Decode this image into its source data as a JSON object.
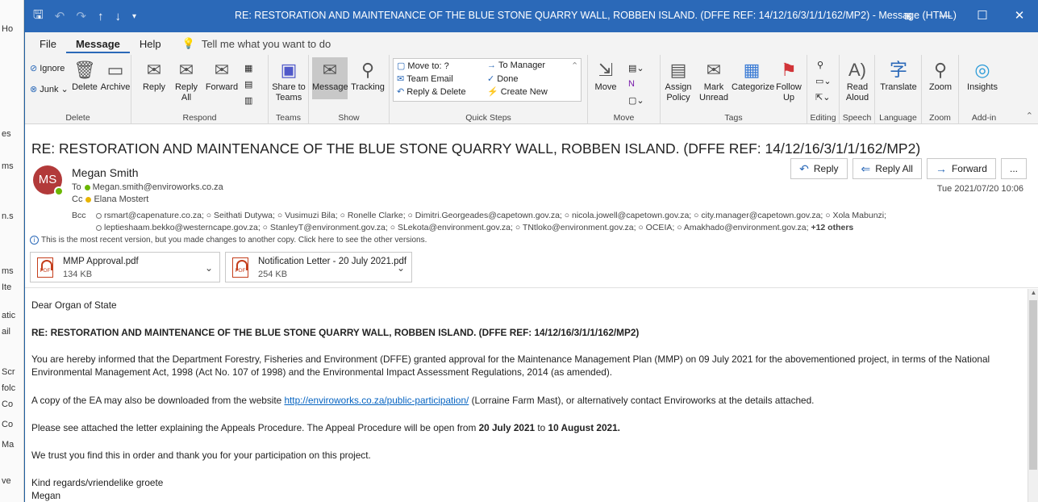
{
  "bg_strip": [
    "Ho",
    "es",
    "ms",
    "n.s",
    "ms",
    "Ite",
    "atic",
    "ail",
    "Scr",
    "folc",
    "Co",
    "Co",
    "Ma",
    "ve"
  ],
  "titlebar": {
    "title": "RE: RESTORATION AND MAINTENANCE OF THE BLUE STONE QUARRY WALL, ROBBEN ISLAND. (DFFE REF: 14/12/16/3/1/1/162/MP2)  -  Message (HTML)",
    "quick_access": [
      "save-icon",
      "undo-icon",
      "redo-icon",
      "up-arrow-icon",
      "down-arrow-icon"
    ],
    "controls": [
      "ribbon-display-icon",
      "minimize-icon",
      "maximize-icon",
      "close-icon"
    ]
  },
  "menu": {
    "items": [
      "File",
      "Message",
      "Help"
    ],
    "active": "Message",
    "tell_me": "Tell me what you want to do"
  },
  "ribbon": {
    "delete": {
      "ignore": "Ignore",
      "junk": "Junk",
      "delete": "Delete",
      "archive": "Archive",
      "label": "Delete"
    },
    "respond": {
      "reply": "Reply",
      "reply_all": "Reply All",
      "forward": "Forward",
      "label": "Respond"
    },
    "teams": {
      "share": "Share to Teams",
      "label": "Teams"
    },
    "show": {
      "message": "Message",
      "tracking": "Tracking",
      "label": "Show"
    },
    "quick_steps": {
      "items": [
        "Move to: ?",
        "Team Email",
        "Reply & Delete",
        "To Manager",
        "Done",
        "Create New"
      ],
      "label": "Quick Steps"
    },
    "move": {
      "move": "Move",
      "label": "Move"
    },
    "tags": {
      "assign_policy": "Assign Policy",
      "mark_unread": "Mark Unread",
      "categorize": "Categorize",
      "follow_up": "Follow Up",
      "label": "Tags"
    },
    "editing": {
      "label": "Editing"
    },
    "speech": {
      "read_aloud": "Read Aloud",
      "label": "Speech"
    },
    "language": {
      "translate": "Translate",
      "label": "Language"
    },
    "zoom": {
      "zoom": "Zoom",
      "label": "Zoom"
    },
    "addin": {
      "insights": "Insights",
      "label": "Add-in"
    }
  },
  "message": {
    "subject": "RE: RESTORATION AND MAINTENANCE OF THE BLUE STONE QUARRY WALL, ROBBEN ISLAND. (DFFE REF: 14/12/16/3/1/1/162/MP2)",
    "avatar_initials": "MS",
    "sender": "Megan Smith",
    "to_label": "To",
    "to": "Megan.smith@enviroworks.co.za",
    "cc_label": "Cc",
    "cc": "Elana Mostert",
    "bcc_label": "Bcc",
    "bcc_line1": "rsmart@capenature.co.za; ○ Seithati Dutywa; ○ Vusimuzi Bila; ○ Ronelle Clarke; ○ Dimitri.Georgeades@capetown.gov.za; ○ nicola.jowell@capetown.gov.za; ○ city.manager@capetown.gov.za; ○ Xola Mabunzi;",
    "bcc_line2": "leptieshaam.bekko@westerncape.gov.za; ○ StanleyT@environment.gov.za; ○ SLekota@environment.gov.za; ○ TNtloko@environment.gov.za; ○ OCEIA; ○ Amakhado@environment.gov.za;",
    "bcc_more": "+12 others",
    "date": "Tue 2021/07/20 10:06",
    "actions": {
      "reply": "Reply",
      "reply_all": "Reply All",
      "forward": "Forward",
      "more": "..."
    },
    "notice": "This is the most recent version, but you made changes to another copy. Click here to see the other versions.",
    "attachments": [
      {
        "name": "MMP Approval.pdf",
        "size": "134 KB"
      },
      {
        "name": "Notification Letter - 20 July 2021.pdf",
        "size": "254 KB"
      }
    ]
  },
  "body": {
    "greeting": "Dear Organ of State",
    "heading": "RE: RESTORATION AND MAINTENANCE OF THE BLUE STONE QUARRY WALL, ROBBEN ISLAND. (DFFE REF: 14/12/16/3/1/1/162/MP2)",
    "para1": "You are hereby informed that the Department Forestry, Fisheries and Environment (DFFE) granted approval for the Maintenance Management Plan (MMP) on 09 July 2021 for the abovementioned project, in terms of the National Environmental Management Act, 1998 (Act No. 107 of 1998) and the Environmental Impact Assessment Regulations, 2014 (as amended).",
    "para2_a": "A copy of the EA may also be downloaded from the website ",
    "para2_link": "http://enviroworks.co.za/public-participation/",
    "para2_b": " (Lorraine Farm Mast), or alternatively contact Enviroworks at the details attached.",
    "para3_a": "Please see attached the letter explaining the Appeals Procedure. The Appeal Procedure will be open from ",
    "para3_d1": "20 July 2021",
    "para3_mid": " to ",
    "para3_d2": "10 August 2021.",
    "para4": "We trust you find this in order and thank you for your participation on this project.",
    "sign1": "Kind regards/vriendelike groete",
    "sign2": "Megan"
  }
}
